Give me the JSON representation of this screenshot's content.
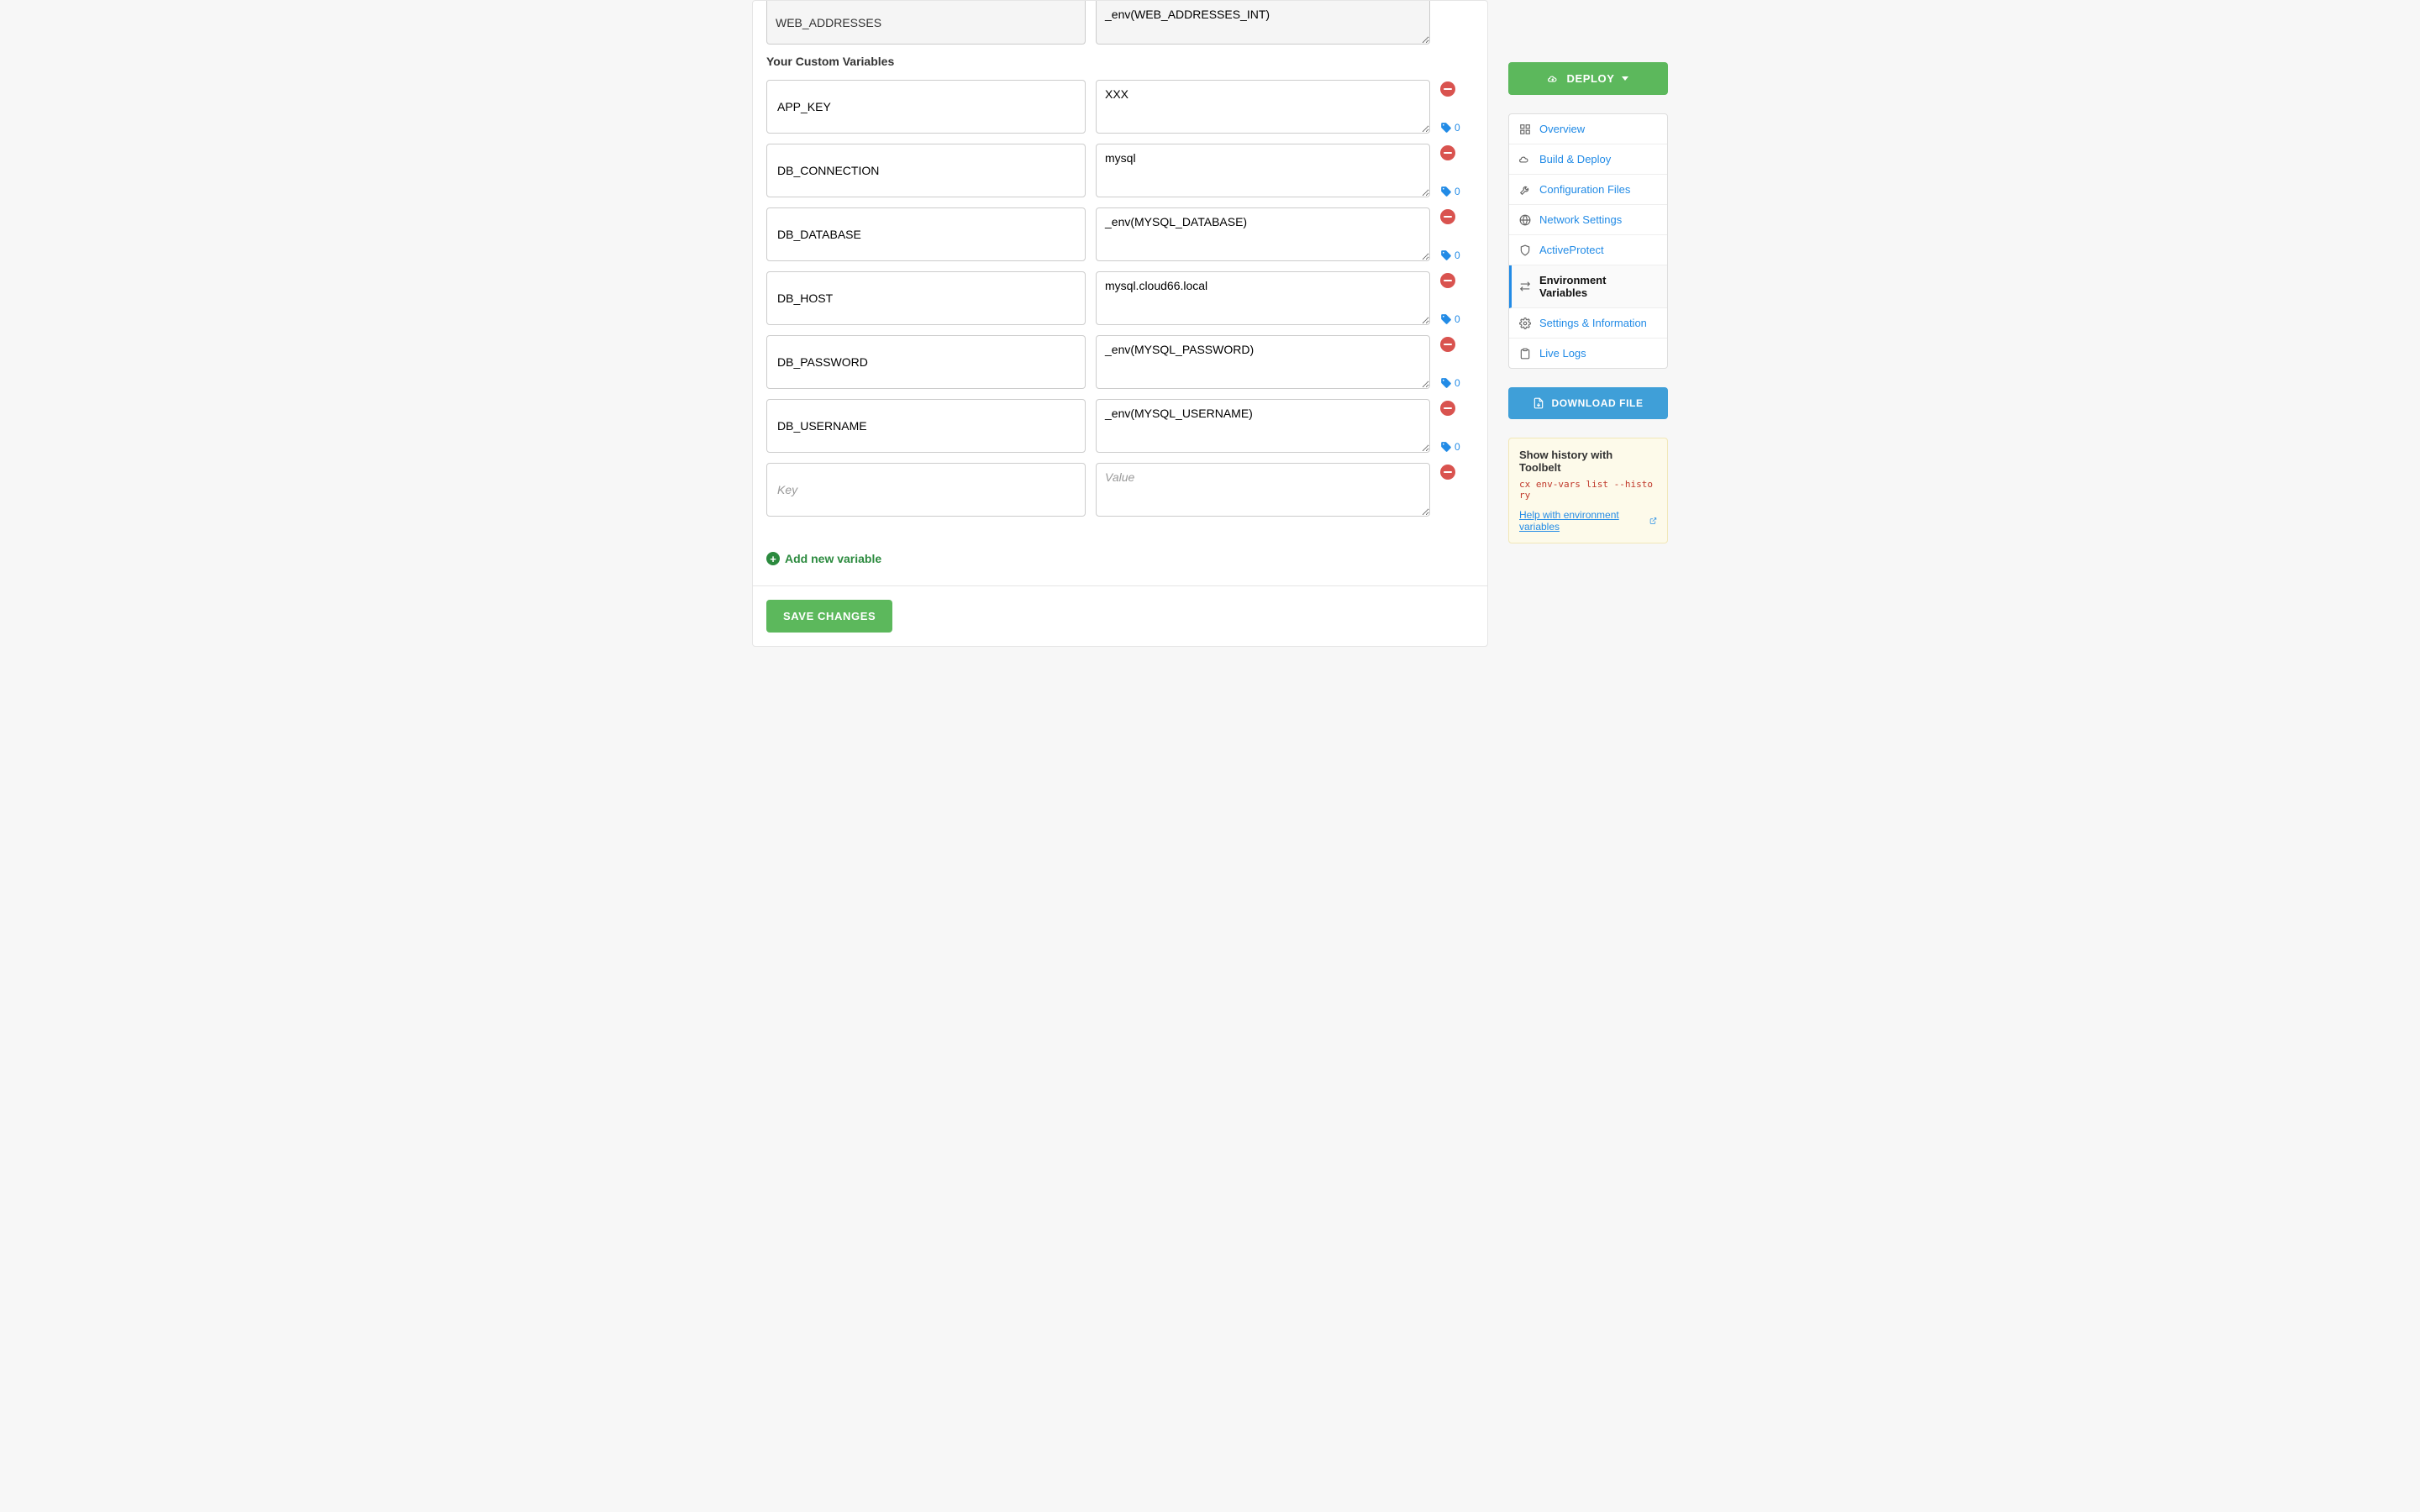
{
  "readonly_row": {
    "key": "WEB_ADDRESSES",
    "value": "_env(WEB_ADDRESSES_INT)"
  },
  "section_title": "Your Custom Variables",
  "custom_vars": [
    {
      "key": "APP_KEY",
      "value": "XXX",
      "tag_count": "0"
    },
    {
      "key": "DB_CONNECTION",
      "value": "mysql",
      "tag_count": "0"
    },
    {
      "key": "DB_DATABASE",
      "value": "_env(MYSQL_DATABASE)",
      "tag_count": "0"
    },
    {
      "key": "DB_HOST",
      "value": "mysql.cloud66.local",
      "tag_count": "0"
    },
    {
      "key": "DB_PASSWORD",
      "value": "_env(MYSQL_PASSWORD)",
      "tag_count": "0"
    },
    {
      "key": "DB_USERNAME",
      "value": "_env(MYSQL_USERNAME)",
      "tag_count": "0"
    }
  ],
  "new_row": {
    "key_placeholder": "Key",
    "value_placeholder": "Value"
  },
  "add_link": "Add new variable",
  "save_button": "SAVE CHANGES",
  "deploy_button": "DEPLOY",
  "download_button": "DOWNLOAD FILE",
  "sidebar_nav": {
    "overview": "Overview",
    "build_deploy": "Build & Deploy",
    "config_files": "Configuration Files",
    "network": "Network Settings",
    "activeprotect": "ActiveProtect",
    "env_vars": "Environment Variables",
    "settings_info": "Settings & Information",
    "live_logs": "Live Logs"
  },
  "help_panel": {
    "title": "Show history with Toolbelt",
    "code": "cx env-vars list --history",
    "link_text": "Help with environment variables"
  }
}
